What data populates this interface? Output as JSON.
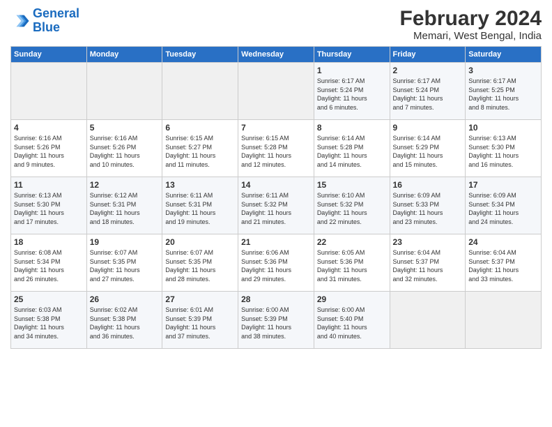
{
  "logo": {
    "line1": "General",
    "line2": "Blue"
  },
  "title": "February 2024",
  "location": "Memari, West Bengal, India",
  "weekdays": [
    "Sunday",
    "Monday",
    "Tuesday",
    "Wednesday",
    "Thursday",
    "Friday",
    "Saturday"
  ],
  "weeks": [
    [
      {
        "day": "",
        "info": ""
      },
      {
        "day": "",
        "info": ""
      },
      {
        "day": "",
        "info": ""
      },
      {
        "day": "",
        "info": ""
      },
      {
        "day": "1",
        "info": "Sunrise: 6:17 AM\nSunset: 5:24 PM\nDaylight: 11 hours\nand 6 minutes."
      },
      {
        "day": "2",
        "info": "Sunrise: 6:17 AM\nSunset: 5:24 PM\nDaylight: 11 hours\nand 7 minutes."
      },
      {
        "day": "3",
        "info": "Sunrise: 6:17 AM\nSunset: 5:25 PM\nDaylight: 11 hours\nand 8 minutes."
      }
    ],
    [
      {
        "day": "4",
        "info": "Sunrise: 6:16 AM\nSunset: 5:26 PM\nDaylight: 11 hours\nand 9 minutes."
      },
      {
        "day": "5",
        "info": "Sunrise: 6:16 AM\nSunset: 5:26 PM\nDaylight: 11 hours\nand 10 minutes."
      },
      {
        "day": "6",
        "info": "Sunrise: 6:15 AM\nSunset: 5:27 PM\nDaylight: 11 hours\nand 11 minutes."
      },
      {
        "day": "7",
        "info": "Sunrise: 6:15 AM\nSunset: 5:28 PM\nDaylight: 11 hours\nand 12 minutes."
      },
      {
        "day": "8",
        "info": "Sunrise: 6:14 AM\nSunset: 5:28 PM\nDaylight: 11 hours\nand 14 minutes."
      },
      {
        "day": "9",
        "info": "Sunrise: 6:14 AM\nSunset: 5:29 PM\nDaylight: 11 hours\nand 15 minutes."
      },
      {
        "day": "10",
        "info": "Sunrise: 6:13 AM\nSunset: 5:30 PM\nDaylight: 11 hours\nand 16 minutes."
      }
    ],
    [
      {
        "day": "11",
        "info": "Sunrise: 6:13 AM\nSunset: 5:30 PM\nDaylight: 11 hours\nand 17 minutes."
      },
      {
        "day": "12",
        "info": "Sunrise: 6:12 AM\nSunset: 5:31 PM\nDaylight: 11 hours\nand 18 minutes."
      },
      {
        "day": "13",
        "info": "Sunrise: 6:11 AM\nSunset: 5:31 PM\nDaylight: 11 hours\nand 19 minutes."
      },
      {
        "day": "14",
        "info": "Sunrise: 6:11 AM\nSunset: 5:32 PM\nDaylight: 11 hours\nand 21 minutes."
      },
      {
        "day": "15",
        "info": "Sunrise: 6:10 AM\nSunset: 5:32 PM\nDaylight: 11 hours\nand 22 minutes."
      },
      {
        "day": "16",
        "info": "Sunrise: 6:09 AM\nSunset: 5:33 PM\nDaylight: 11 hours\nand 23 minutes."
      },
      {
        "day": "17",
        "info": "Sunrise: 6:09 AM\nSunset: 5:34 PM\nDaylight: 11 hours\nand 24 minutes."
      }
    ],
    [
      {
        "day": "18",
        "info": "Sunrise: 6:08 AM\nSunset: 5:34 PM\nDaylight: 11 hours\nand 26 minutes."
      },
      {
        "day": "19",
        "info": "Sunrise: 6:07 AM\nSunset: 5:35 PM\nDaylight: 11 hours\nand 27 minutes."
      },
      {
        "day": "20",
        "info": "Sunrise: 6:07 AM\nSunset: 5:35 PM\nDaylight: 11 hours\nand 28 minutes."
      },
      {
        "day": "21",
        "info": "Sunrise: 6:06 AM\nSunset: 5:36 PM\nDaylight: 11 hours\nand 29 minutes."
      },
      {
        "day": "22",
        "info": "Sunrise: 6:05 AM\nSunset: 5:36 PM\nDaylight: 11 hours\nand 31 minutes."
      },
      {
        "day": "23",
        "info": "Sunrise: 6:04 AM\nSunset: 5:37 PM\nDaylight: 11 hours\nand 32 minutes."
      },
      {
        "day": "24",
        "info": "Sunrise: 6:04 AM\nSunset: 5:37 PM\nDaylight: 11 hours\nand 33 minutes."
      }
    ],
    [
      {
        "day": "25",
        "info": "Sunrise: 6:03 AM\nSunset: 5:38 PM\nDaylight: 11 hours\nand 34 minutes."
      },
      {
        "day": "26",
        "info": "Sunrise: 6:02 AM\nSunset: 5:38 PM\nDaylight: 11 hours\nand 36 minutes."
      },
      {
        "day": "27",
        "info": "Sunrise: 6:01 AM\nSunset: 5:39 PM\nDaylight: 11 hours\nand 37 minutes."
      },
      {
        "day": "28",
        "info": "Sunrise: 6:00 AM\nSunset: 5:39 PM\nDaylight: 11 hours\nand 38 minutes."
      },
      {
        "day": "29",
        "info": "Sunrise: 6:00 AM\nSunset: 5:40 PM\nDaylight: 11 hours\nand 40 minutes."
      },
      {
        "day": "",
        "info": ""
      },
      {
        "day": "",
        "info": ""
      }
    ]
  ]
}
